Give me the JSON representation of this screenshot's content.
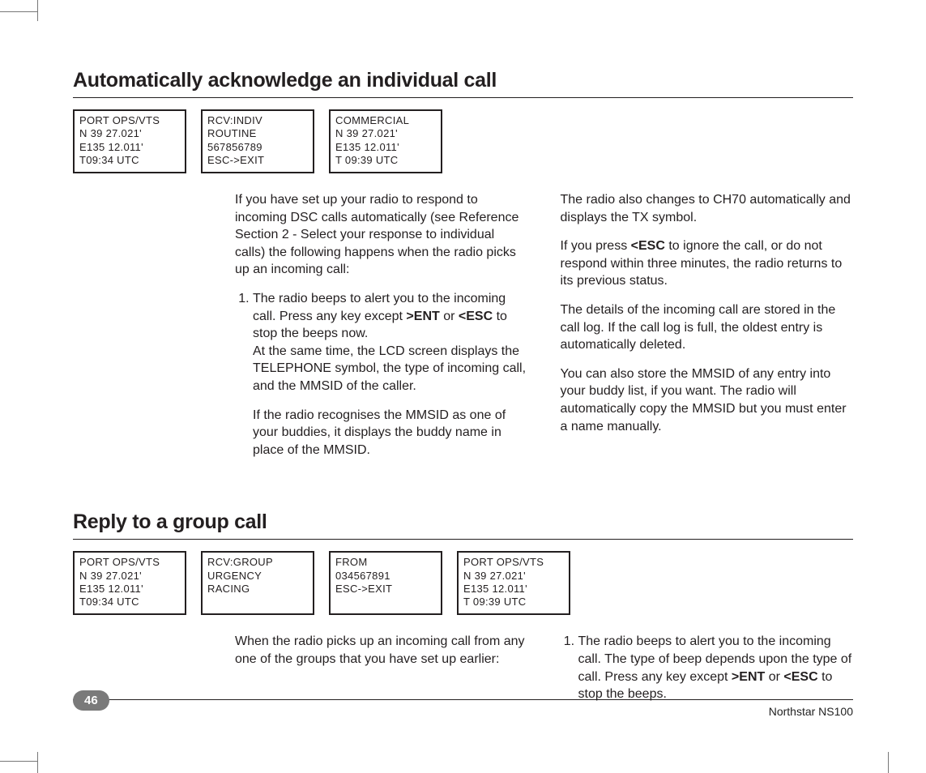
{
  "section1": {
    "heading": "Automatically acknowledge an individual call",
    "screens": [
      "PORT OPS/VTS\nN 39 27.021'\nE135 12.011'\nT09:34 UTC",
      "RCV:INDIV\nROUTINE\n567856789\nESC->EXIT",
      "COMMERCIAL\nN 39 27.021'\nE135 12.011'\nT 09:39 UTC"
    ],
    "left_intro": "If you have set up your radio to respond to incoming DSC calls automatically (see Reference Section 2 - Select your response to individual calls) the following happens when the radio picks up an incoming call:",
    "left_item1_a": "The radio beeps to alert you to the incoming call. Press any key except ",
    "left_item1_b": ">ENT",
    "left_item1_c": " or ",
    "left_item1_d": "<ESC",
    "left_item1_e": " to stop the beeps now.",
    "left_item1_p2": "At the same time, the LCD screen displays the TELEPHONE symbol, the type of incoming call, and the MMSID of the caller.",
    "left_item1_p3": "If the radio recognises the MMSID as one of your buddies, it displays the buddy name in place of the MMSID.",
    "right_p1": "The radio also changes to CH70 automatically and displays the TX symbol.",
    "right_p2_a": "If you press ",
    "right_p2_b": "<ESC",
    "right_p2_c": " to ignore the call, or do not respond within three minutes, the radio returns to its previous status.",
    "right_p3": "The details of the incoming call are stored in the call log. If the call log is full, the oldest entry is automatically deleted.",
    "right_p4": "You can also store the MMSID of any entry into your buddy list, if you want. The radio will automatically copy the MMSID but you must enter a name manually."
  },
  "section2": {
    "heading": "Reply to a group call",
    "screens": [
      "PORT OPS/VTS\nN 39 27.021'\nE135 12.011'\nT09:34 UTC",
      "RCV:GROUP\nURGENCY\nRACING",
      "FROM\n034567891\nESC->EXIT",
      "PORT OPS/VTS\nN 39 27.021'\nE135 12.011'\nT 09:39 UTC"
    ],
    "left_p1": "When the radio picks up an incoming call from any one of the groups that you have set up earlier:",
    "right_item1_a": "The radio beeps to alert you to the incoming call. The type of beep depends upon the type of call. Press any key except ",
    "right_item1_b": ">ENT",
    "right_item1_c": " or ",
    "right_item1_d": "<ESC",
    "right_item1_e": " to stop the beeps."
  },
  "footer": {
    "page": "46",
    "title": "Northstar NS100"
  }
}
